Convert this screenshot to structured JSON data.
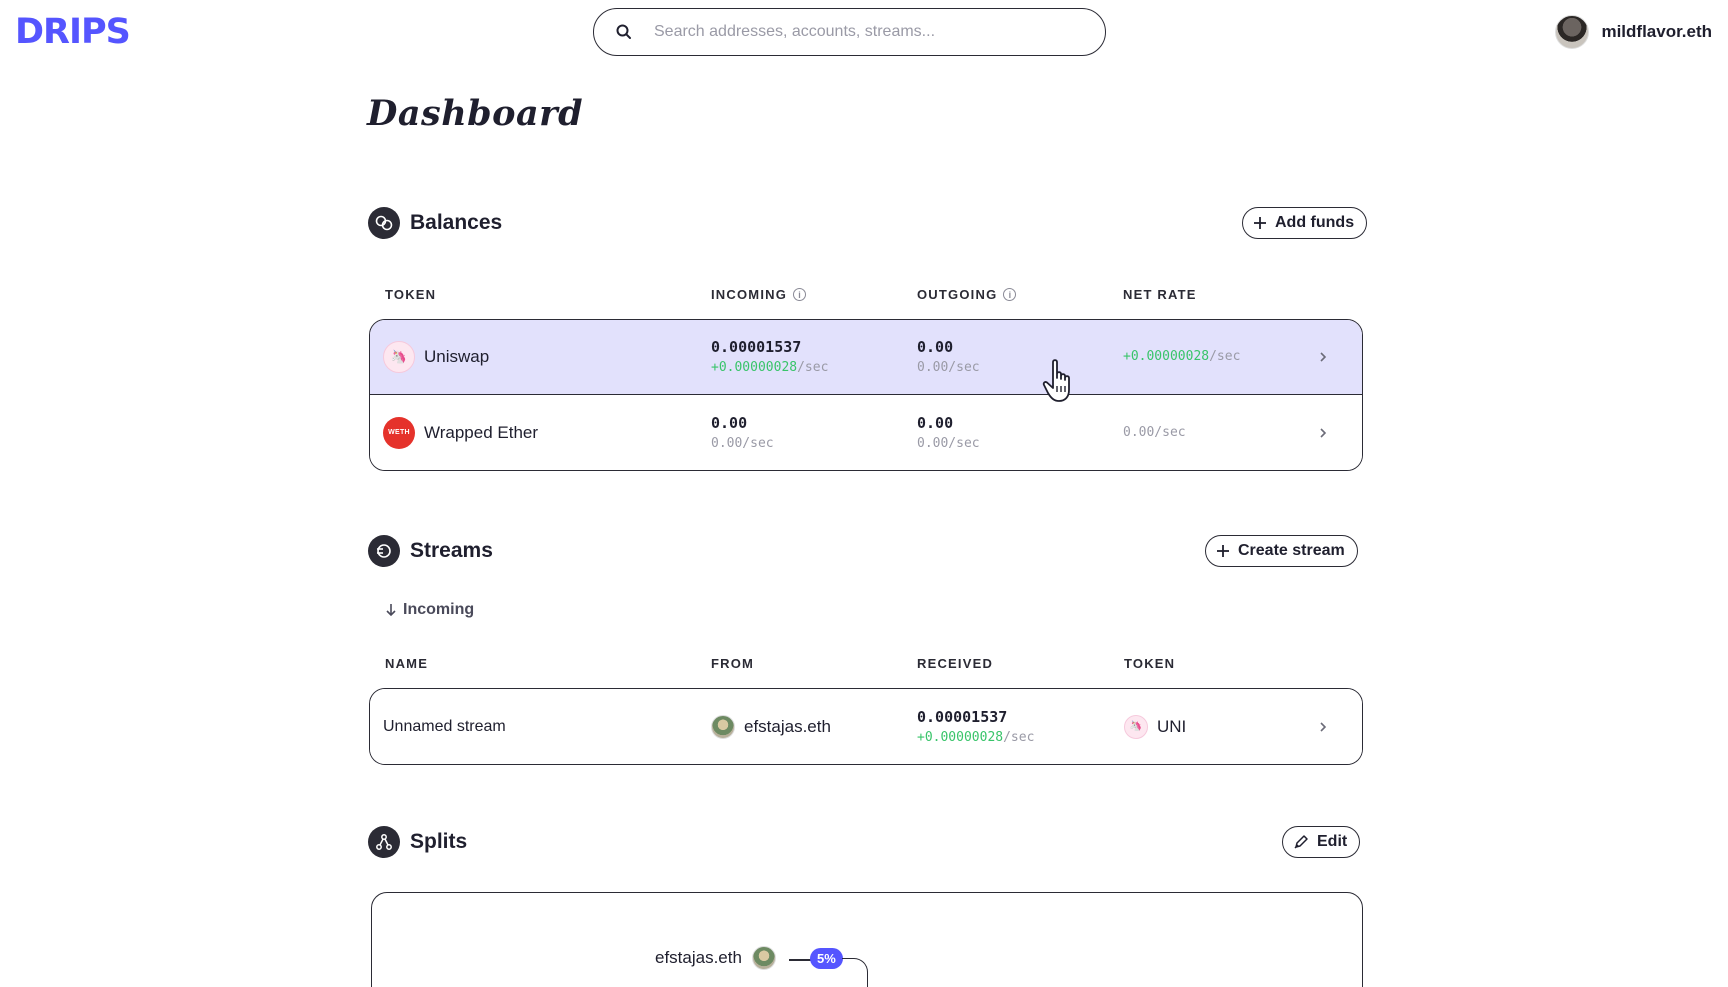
{
  "header": {
    "logo": "DRIPS",
    "search_placeholder": "Search addresses, accounts, streams...",
    "user": {
      "name": "mildflavor.eth"
    }
  },
  "page": {
    "title": "Dashboard"
  },
  "balances": {
    "title": "Balances",
    "add_funds_label": "Add funds",
    "columns": {
      "token": "TOKEN",
      "incoming": "INCOMING",
      "outgoing": "OUTGOING",
      "net_rate": "NET RATE"
    },
    "rows": [
      {
        "token": "Uniswap",
        "incoming": "0.00001537",
        "incoming_rate_value": "+0.00000028",
        "incoming_rate_unit": "/sec",
        "outgoing": "0.00",
        "outgoing_rate": "0.00/sec",
        "net_rate_value": "+0.00000028",
        "net_rate_unit": "/sec"
      },
      {
        "token": "Wrapped Ether",
        "badge": "WETH",
        "incoming": "0.00",
        "incoming_rate": "0.00/sec",
        "outgoing": "0.00",
        "outgoing_rate": "0.00/sec",
        "net_rate": "0.00/sec"
      }
    ]
  },
  "streams": {
    "title": "Streams",
    "create_label": "Create stream",
    "tab": "Incoming",
    "columns": {
      "name": "NAME",
      "from": "FROM",
      "received": "RECEIVED",
      "token": "TOKEN"
    },
    "rows": [
      {
        "name": "Unnamed stream",
        "from": "efstajas.eth",
        "received": "0.00001537",
        "received_rate_value": "+0.00000028",
        "received_rate_unit": "/sec",
        "token": "UNI"
      }
    ]
  },
  "splits": {
    "title": "Splits",
    "edit_label": "Edit",
    "node": {
      "name": "efstajas.eth",
      "percent": "5%"
    }
  },
  "colors": {
    "accent": "#5555ff",
    "highlight_row": "#e2e1fc",
    "positive": "#39c46a",
    "muted": "#9a9aa6"
  }
}
